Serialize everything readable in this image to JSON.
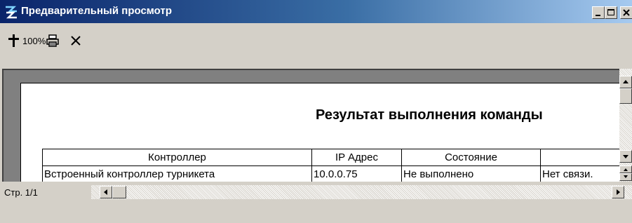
{
  "window": {
    "title": "Предварительный просмотр",
    "title_bar_color": "#0a246a"
  },
  "toolbar": {
    "zoom_icon": "zoom-pin-icon",
    "zoom_label": "100%",
    "print_icon": "printer-icon",
    "close_icon": "close-x-icon"
  },
  "report": {
    "title": "Результат выполнения команды",
    "columns": [
      "Контроллер",
      "IP Адрес",
      "Состояние",
      ""
    ],
    "rows": [
      [
        "Встроенный контроллер турникета",
        "10.0.0.75",
        "Не выполнено",
        "Нет связи."
      ]
    ]
  },
  "statusbar": {
    "page": "Стр. 1/1"
  }
}
